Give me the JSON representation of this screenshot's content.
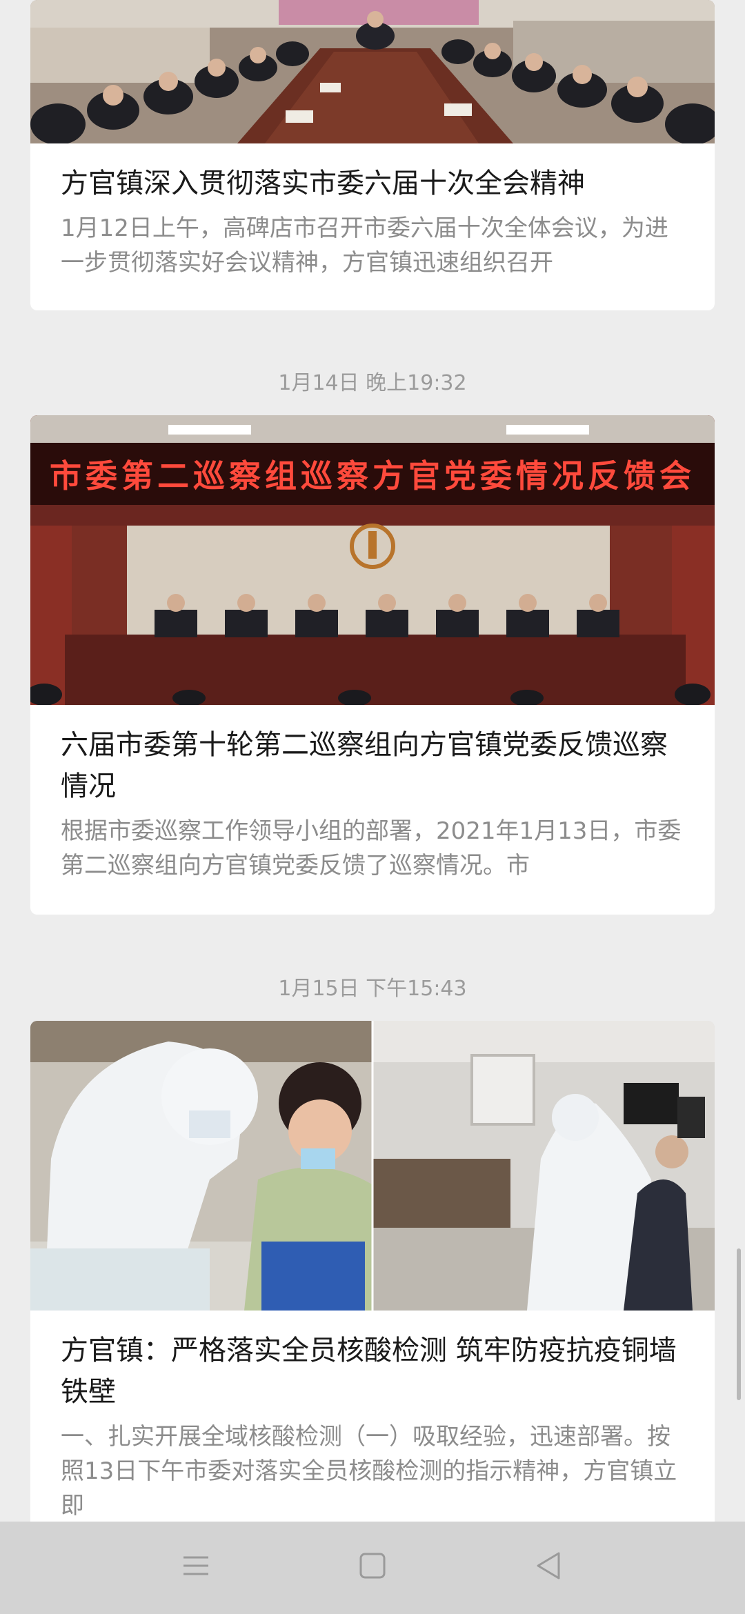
{
  "articles": [
    {
      "title": "方官镇深入贯彻落实市委六届十次全会精神",
      "summary": "1月12日上午，高碑店市召开市委六届十次全体会议，为进一步贯彻落实好会议精神，方官镇迅速组织召开"
    },
    {
      "timestamp": "1月14日 晚上19:32",
      "banner": "市委第二巡察组巡察方官党委情况反馈会",
      "title": "六届市委第十轮第二巡察组向方官镇党委反馈巡察情况",
      "summary": "根据市委巡察工作领导小组的部署，2021年1月13日，市委第二巡察组向方官镇党委反馈了巡察情况。市"
    },
    {
      "timestamp": "1月15日 下午15:43",
      "title": "方官镇：严格落实全员核酸检测 筑牢防疫抗疫铜墙铁壁",
      "summary": "一、扎实开展全域核酸检测（一）吸取经验，迅速部署。按照13日下午市委对落实全员核酸检测的指示精神，方官镇立即"
    }
  ],
  "nav": {
    "menu_icon": "menu-icon",
    "home_icon": "home-square-icon",
    "back_icon": "back-triangle-icon"
  }
}
